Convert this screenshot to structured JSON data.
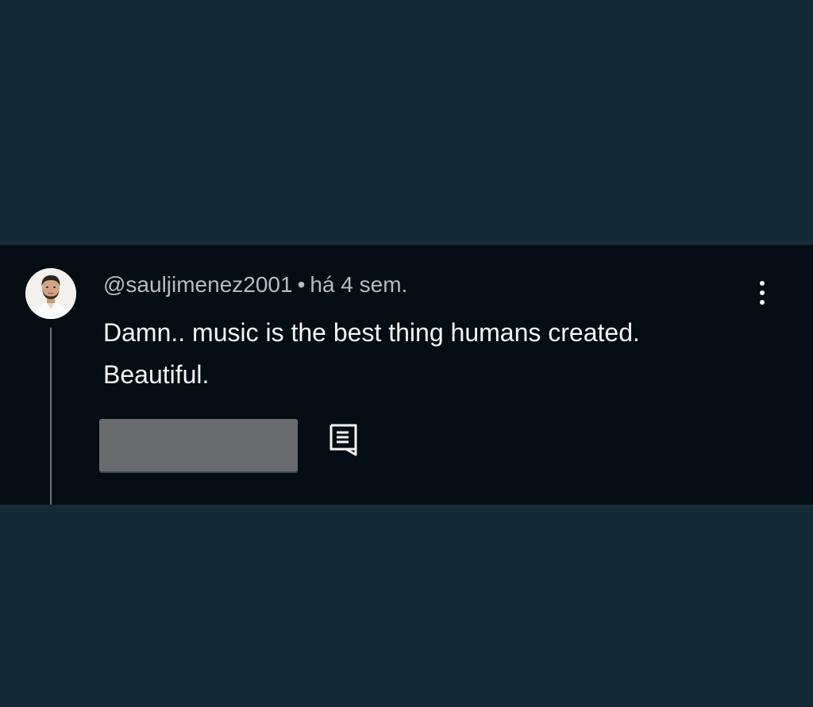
{
  "comment": {
    "author": "@sauljimenez2001",
    "separator": "•",
    "timestamp": "há 4 sem.",
    "text_line_1": "Damn.. music is the best thing humans created.",
    "text_line_2": "Beautiful."
  },
  "icons": {
    "more": "more-vertical-icon",
    "reply": "reply-comment-icon"
  },
  "colors": {
    "page_background": "#162a36",
    "card_background": "#050d14",
    "primary_text": "#f5f5f5",
    "secondary_text": "#b8bcbf",
    "redaction": "#6a6b6f"
  }
}
